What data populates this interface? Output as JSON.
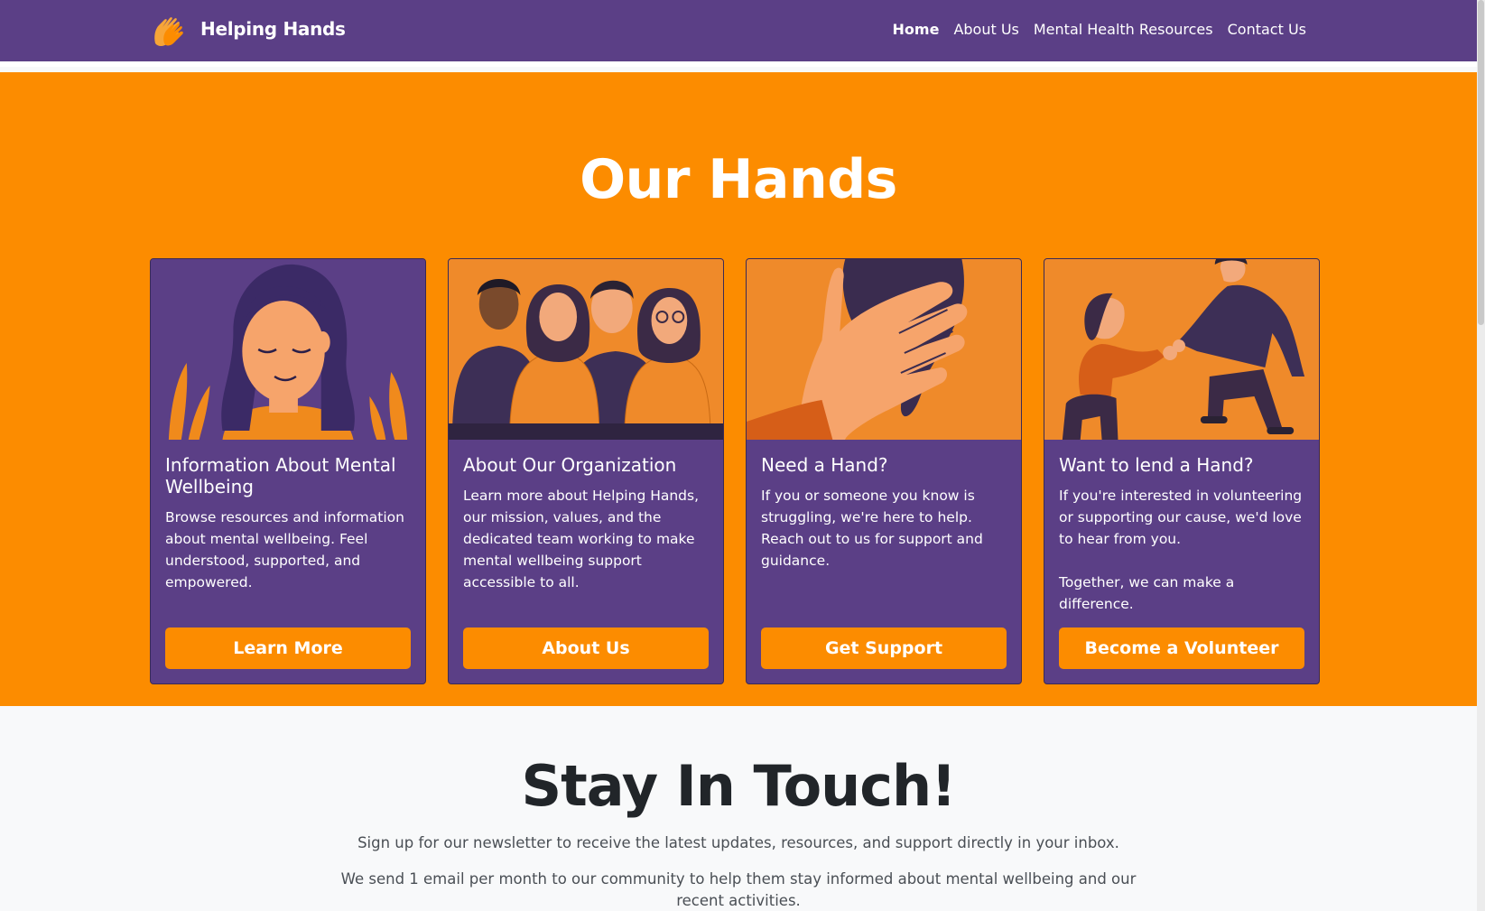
{
  "nav": {
    "brand": "Helping Hands",
    "links": [
      "Home",
      "About Us",
      "Mental Health Resources",
      "Contact Us"
    ],
    "active": "Home"
  },
  "hero": {
    "title": "Our Hands",
    "cards": [
      {
        "image": "woman-meditating-illustration",
        "title": "Information About Mental Wellbeing",
        "text": "Browse resources and information about mental wellbeing. Feel understood, supported, and empowered.",
        "button": "Learn More"
      },
      {
        "image": "team-group-illustration",
        "title": "About Our Organization",
        "text": "Learn more about Helping Hands, our mission, values, and the dedicated team working to make mental wellbeing support accessible to all.",
        "button": "About Us"
      },
      {
        "image": "holding-hands-illustration",
        "title": "Need a Hand?",
        "text": "If you or someone you know is struggling, we're here to help. Reach out to us for support and guidance.",
        "button": "Get Support"
      },
      {
        "image": "helping-up-illustration",
        "title": "Want to lend a Hand?",
        "text": "If you're interested in volunteering or supporting our cause, we'd love to hear from you.\n\nTogether, we can make a difference.",
        "button": "Become a Volunteer"
      }
    ]
  },
  "newsletter": {
    "title": "Stay In Touch!",
    "line1": "Sign up for our newsletter to receive the latest updates, resources, and support directly in your inbox.",
    "line2": "We send 1 email per month to our community to help them stay informed about mental wellbeing and our recent activities."
  },
  "colors": {
    "purple": "#5b3f86",
    "orange": "#fc8c00",
    "light": "#f8f9fa",
    "dark": "#212529"
  }
}
